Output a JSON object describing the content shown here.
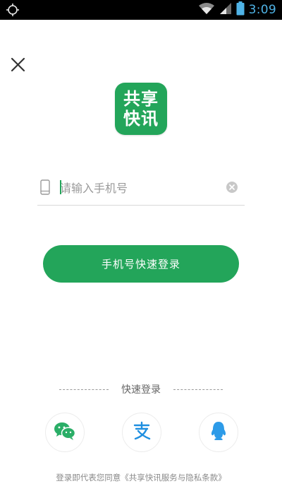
{
  "status_bar": {
    "time": "3:09",
    "icons": [
      "location-target-icon",
      "wifi-icon",
      "signal-icon",
      "battery-icon"
    ]
  },
  "header": {
    "close_icon": "close-icon"
  },
  "logo": {
    "line1": "共享",
    "line2": "快讯",
    "color": "#23a55a"
  },
  "phone_input": {
    "placeholder": "请输入手机号",
    "value": "",
    "icon": "phone-icon",
    "clear_icon": "clear-icon"
  },
  "login_button": {
    "label": "手机号快速登录",
    "color": "#23a55a"
  },
  "quick_login": {
    "label": "快速登录",
    "options": [
      {
        "name": "wechat",
        "icon": "wechat-icon",
        "color": "#2aae67"
      },
      {
        "name": "alipay",
        "icon": "alipay-icon",
        "color": "#1f8fe0"
      },
      {
        "name": "qq",
        "icon": "qq-icon",
        "color": "#2d9be8"
      }
    ]
  },
  "agreement": {
    "prefix": "登录即代表您同意",
    "link": "《共享快讯服务与隐私条款》"
  }
}
